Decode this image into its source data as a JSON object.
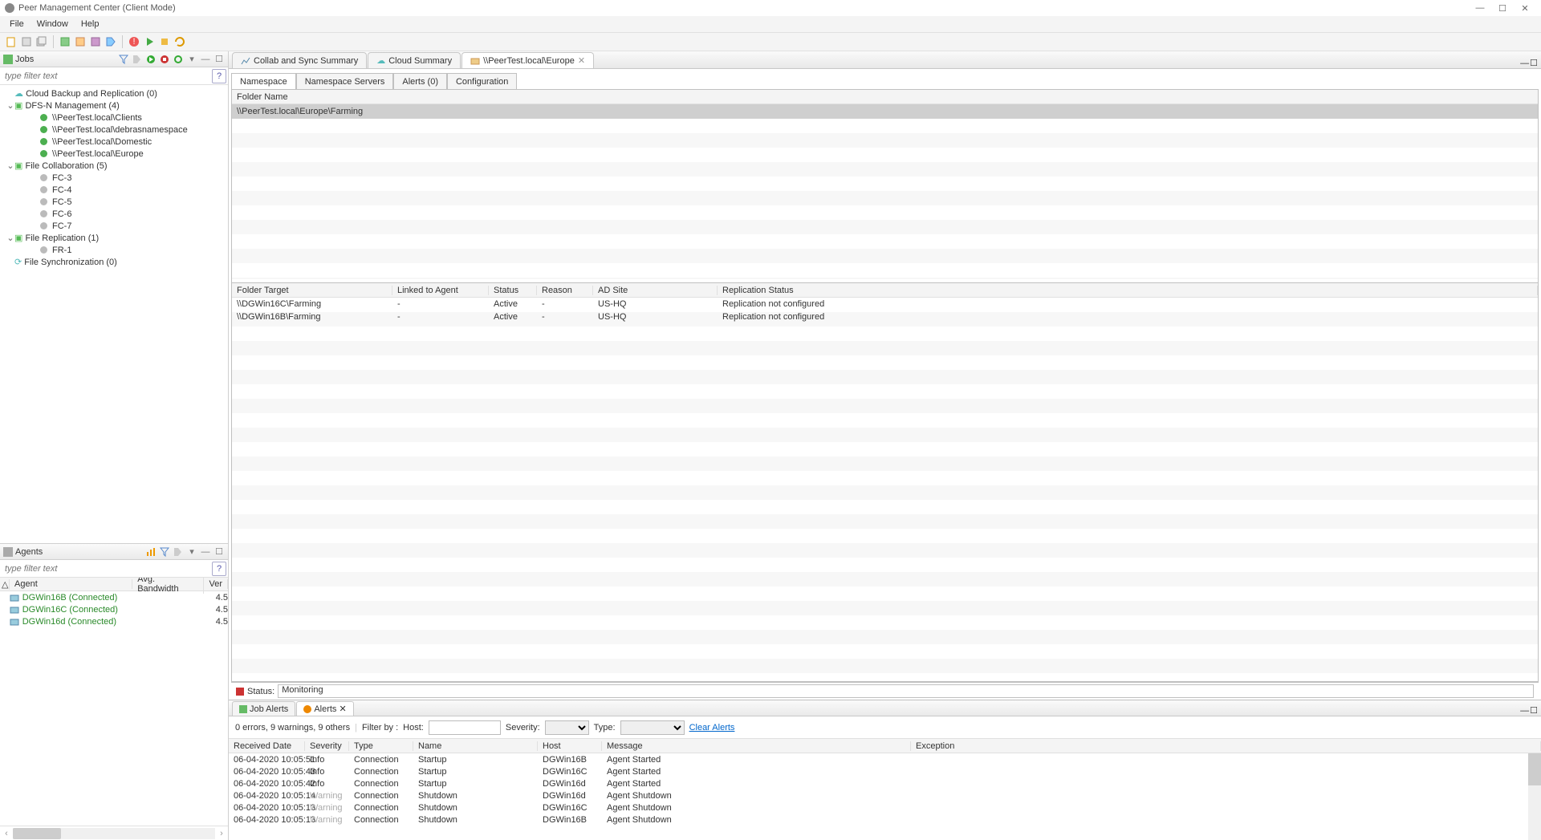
{
  "title": "Peer Management Center (Client Mode)",
  "menubar": [
    "File",
    "Window",
    "Help"
  ],
  "jobs_panel": {
    "title": "Jobs",
    "filter_placeholder": "type filter text",
    "tree": [
      {
        "level": 0,
        "icon": "cloud",
        "label": "Cloud Backup and Replication (0)"
      },
      {
        "level": 0,
        "icon": "folder",
        "label": "DFS-N Management (4)",
        "caret": "down"
      },
      {
        "level": 2,
        "icon": "green",
        "label": "\\\\PeerTest.local\\Clients"
      },
      {
        "level": 2,
        "icon": "green",
        "label": "\\\\PeerTest.local\\debrasnamespace"
      },
      {
        "level": 2,
        "icon": "green",
        "label": "\\\\PeerTest.local\\Domestic"
      },
      {
        "level": 2,
        "icon": "green",
        "label": "\\\\PeerTest.local\\Europe"
      },
      {
        "level": 0,
        "icon": "folder",
        "label": "File Collaboration (5)",
        "caret": "down"
      },
      {
        "level": 2,
        "icon": "gray",
        "label": "FC-3"
      },
      {
        "level": 2,
        "icon": "gray",
        "label": "FC-4"
      },
      {
        "level": 2,
        "icon": "gray",
        "label": "FC-5"
      },
      {
        "level": 2,
        "icon": "gray",
        "label": "FC-6"
      },
      {
        "level": 2,
        "icon": "gray",
        "label": "FC-7"
      },
      {
        "level": 0,
        "icon": "folder",
        "label": "File Replication (1)",
        "caret": "down"
      },
      {
        "level": 2,
        "icon": "gray",
        "label": "FR-1"
      },
      {
        "level": 0,
        "icon": "sync",
        "label": "File Synchronization (0)"
      }
    ]
  },
  "agents_panel": {
    "title": "Agents",
    "filter_placeholder": "type filter text",
    "headers": {
      "agent": "Agent",
      "bandwidth": "Avg. Bandwidth",
      "version": "Ver"
    },
    "rows": [
      {
        "name": "DGWin16B (Connected)",
        "bandwidth": "",
        "version": "4.5"
      },
      {
        "name": "DGWin16C (Connected)",
        "bandwidth": "",
        "version": "4.5"
      },
      {
        "name": "DGWin16d (Connected)",
        "bandwidth": "",
        "version": "4.5"
      }
    ]
  },
  "main_tabs": [
    {
      "label": "Collab and Sync Summary",
      "icon": "chart"
    },
    {
      "label": "Cloud Summary",
      "icon": "cloud"
    },
    {
      "label": "\\\\PeerTest.local\\Europe",
      "icon": "folder",
      "active": true,
      "closable": true
    }
  ],
  "sub_tabs": [
    "Namespace",
    "Namespace Servers",
    "Alerts (0)",
    "Configuration"
  ],
  "folder_name_header": "Folder Name",
  "folder_name_row": "\\\\PeerTest.local\\Europe\\Farming",
  "target_headers": {
    "ft": "Folder Target",
    "la": "Linked to Agent",
    "st": "Status",
    "re": "Reason",
    "ad": "AD Site",
    "rs": "Replication Status"
  },
  "target_rows": [
    {
      "ft": "\\\\DGWin16C\\Farming",
      "la": "-",
      "st": "Active",
      "re": "-",
      "ad": "US-HQ",
      "rs": "Replication not configured"
    },
    {
      "ft": "\\\\DGWin16B\\Farming",
      "la": "-",
      "st": "Active",
      "re": "-",
      "ad": "US-HQ",
      "rs": "Replication not configured"
    }
  ],
  "status_label": "Status:",
  "status_value": "Monitoring",
  "bottom_tabs": [
    {
      "label": "Job Alerts",
      "icon": "green"
    },
    {
      "label": "Alerts",
      "icon": "orange",
      "active": true,
      "closable": true
    }
  ],
  "filter_bar": {
    "summary": "0 errors, 9 warnings, 9 others",
    "filter_by": "Filter by :",
    "host": "Host:",
    "severity": "Severity:",
    "type": "Type:",
    "clear": "Clear Alerts"
  },
  "alert_headers": {
    "rd": "Received Date",
    "sv": "Severity",
    "tp": "Type",
    "nm": "Name",
    "hs": "Host",
    "ms": "Message",
    "ex": "Exception"
  },
  "alert_rows": [
    {
      "rd": "06-04-2020 10:05:51",
      "sv": "Info",
      "tp": "Connection",
      "nm": "Startup",
      "hs": "DGWin16B",
      "ms": "Agent Started"
    },
    {
      "rd": "06-04-2020 10:05:43",
      "sv": "Info",
      "tp": "Connection",
      "nm": "Startup",
      "hs": "DGWin16C",
      "ms": "Agent Started"
    },
    {
      "rd": "06-04-2020 10:05:42",
      "sv": "Info",
      "tp": "Connection",
      "nm": "Startup",
      "hs": "DGWin16d",
      "ms": "Agent Started"
    },
    {
      "rd": "06-04-2020 10:05:14",
      "sv": "Warning",
      "tp": "Connection",
      "nm": "Shutdown",
      "hs": "DGWin16d",
      "ms": "Agent Shutdown"
    },
    {
      "rd": "06-04-2020 10:05:13",
      "sv": "Warning",
      "tp": "Connection",
      "nm": "Shutdown",
      "hs": "DGWin16C",
      "ms": "Agent Shutdown"
    },
    {
      "rd": "06-04-2020 10:05:13",
      "sv": "Warning",
      "tp": "Connection",
      "nm": "Shutdown",
      "hs": "DGWin16B",
      "ms": "Agent Shutdown"
    }
  ]
}
